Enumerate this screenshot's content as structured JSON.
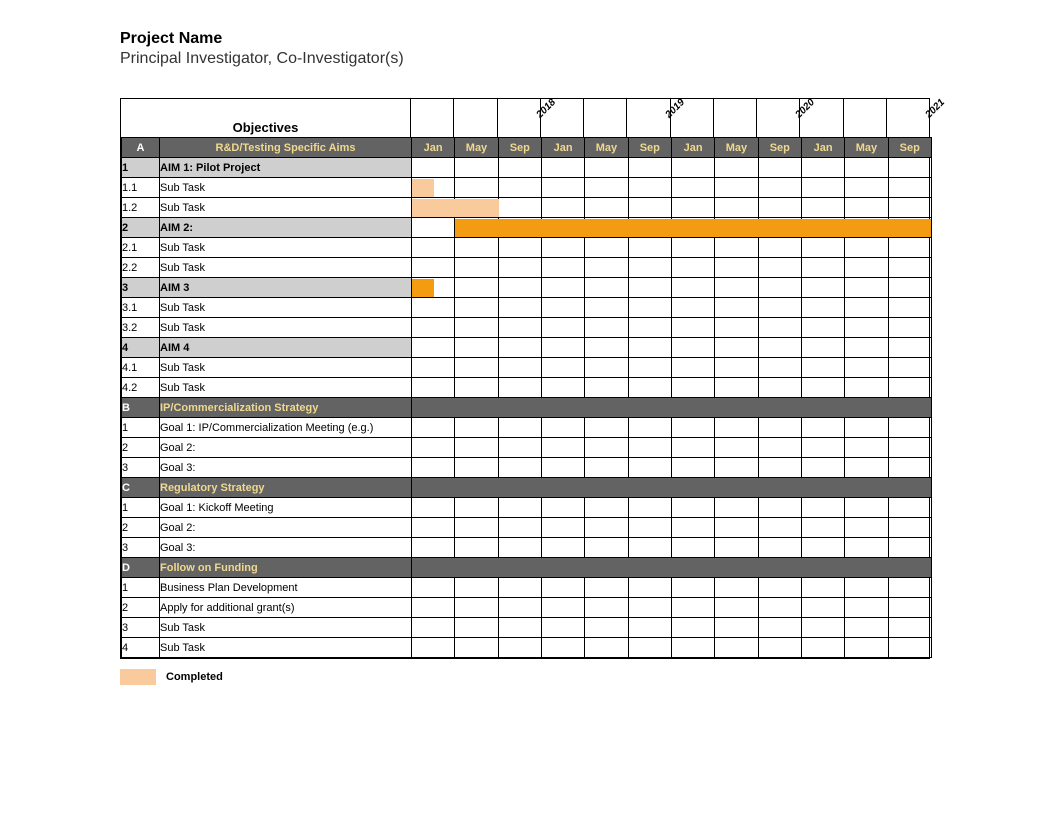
{
  "header": {
    "title": "Project Name",
    "subtitle": "Principal Investigator, Co-Investigator(s)"
  },
  "objectivesLabel": "Objectives",
  "years": [
    "2018",
    "2019",
    "2020",
    "2021"
  ],
  "months": [
    "Jan",
    "May",
    "Sep",
    "Jan",
    "May",
    "Sep",
    "Jan",
    "May",
    "Sep",
    "Jan",
    "May",
    "Sep"
  ],
  "legend": {
    "completed": "Completed"
  },
  "colors": {
    "section_bg": "#636363",
    "section_fg": "#efd88f",
    "aim_bg": "#cfcfcf",
    "bar_light": "#f9cb9c",
    "bar_solid": "#f39c12"
  },
  "chart_data": {
    "type": "bar",
    "title": "Project Gantt Timeline",
    "xlabel": "",
    "ylabel": "",
    "x_categories": [
      "Jan 2018",
      "May 2018",
      "Sep 2018",
      "Jan 2019",
      "May 2019",
      "Sep 2019",
      "Jan 2020",
      "May 2020",
      "Sep 2020",
      "Jan 2021",
      "May 2021",
      "Sep 2021"
    ],
    "series": [
      {
        "name": "1.1 Sub Task",
        "start_month_index": 0,
        "end_month_index": 0.5,
        "status": "completed"
      },
      {
        "name": "1.2 Sub Task",
        "start_month_index": 0,
        "end_month_index": 2,
        "status": "completed"
      },
      {
        "name": "AIM 2:",
        "start_month_index": 1,
        "end_month_index": 12,
        "status": "active"
      },
      {
        "name": "AIM 3",
        "start_month_index": 0,
        "end_month_index": 0.5,
        "status": "active"
      }
    ]
  },
  "rows": [
    {
      "type": "section",
      "id": "A",
      "label": "R&D/Testing Specific Aims",
      "showMonths": true
    },
    {
      "type": "aim",
      "id": "1",
      "label": "AIM 1: Pilot Project"
    },
    {
      "type": "task",
      "id": "1.1",
      "label": "Sub Task",
      "bar": {
        "start": 0,
        "span": 0.5,
        "style": "light"
      }
    },
    {
      "type": "task",
      "id": "1.2",
      "label": "Sub Task",
      "bar": {
        "start": 0,
        "span": 2,
        "style": "light"
      }
    },
    {
      "type": "aim",
      "id": "2",
      "label": "AIM 2:",
      "bar": {
        "start": 1,
        "span": 11,
        "style": "solid"
      }
    },
    {
      "type": "task",
      "id": "2.1",
      "label": "Sub Task"
    },
    {
      "type": "task",
      "id": "2.2",
      "label": "Sub Task"
    },
    {
      "type": "aim",
      "id": "3",
      "label": "AIM 3",
      "bar": {
        "start": 0,
        "span": 0.5,
        "style": "solid"
      }
    },
    {
      "type": "task",
      "id": "3.1",
      "label": "Sub Task"
    },
    {
      "type": "task",
      "id": "3.2",
      "label": "Sub Task"
    },
    {
      "type": "aim",
      "id": "4",
      "label": "AIM 4"
    },
    {
      "type": "task",
      "id": "4.1",
      "label": "Sub Task"
    },
    {
      "type": "task",
      "id": "4.2",
      "label": "Sub Task"
    },
    {
      "type": "section",
      "id": "B",
      "label": "IP/Commercialization Strategy"
    },
    {
      "type": "task",
      "id": "1",
      "label": "Goal 1: IP/Commercialization Meeting (e.g.)"
    },
    {
      "type": "task",
      "id": "2",
      "label": "Goal 2:"
    },
    {
      "type": "task",
      "id": "3",
      "label": "Goal 3:"
    },
    {
      "type": "section",
      "id": "C",
      "label": "Regulatory Strategy"
    },
    {
      "type": "task",
      "id": "1",
      "label": "Goal 1: Kickoff Meeting"
    },
    {
      "type": "task",
      "id": "2",
      "label": "Goal 2:"
    },
    {
      "type": "task",
      "id": "3",
      "label": "Goal 3:"
    },
    {
      "type": "section",
      "id": "D",
      "label": "Follow on Funding"
    },
    {
      "type": "task",
      "id": "1",
      "label": "Business Plan Development"
    },
    {
      "type": "task",
      "id": "2",
      "label": "Apply for additional grant(s)"
    },
    {
      "type": "task",
      "id": "3",
      "label": "Sub Task"
    },
    {
      "type": "task",
      "id": "4",
      "label": "Sub Task"
    }
  ]
}
